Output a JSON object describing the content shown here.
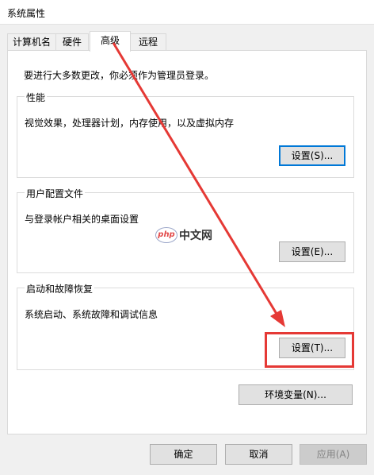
{
  "window": {
    "title": "系统属性"
  },
  "tabs": [
    {
      "label": "计算机名"
    },
    {
      "label": "硬件"
    },
    {
      "label": "高级"
    },
    {
      "label": "远程"
    }
  ],
  "intro_text": "要进行大多数更改，你必须作为管理员登录。",
  "performance": {
    "title": "性能",
    "desc": "视觉效果，处理器计划，内存使用，以及虚拟内存",
    "button": "设置(S)..."
  },
  "user_profiles": {
    "title": "用户配置文件",
    "desc": "与登录帐户相关的桌面设置",
    "button": "设置(E)..."
  },
  "startup_recovery": {
    "title": "启动和故障恢复",
    "desc": "系统启动、系统故障和调试信息",
    "button": "设置(T)..."
  },
  "env_button": "环境变量(N)...",
  "footer": {
    "ok": "确定",
    "cancel": "取消",
    "apply": "应用(A)"
  },
  "watermark": {
    "logo": "php",
    "text": "中文网"
  },
  "colors": {
    "accent": "#0078d7",
    "annotation": "#e53935"
  }
}
